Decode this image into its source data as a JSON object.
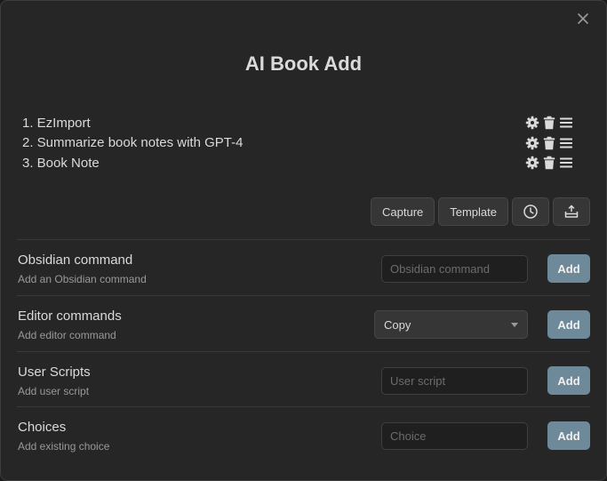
{
  "modal": {
    "title": "AI Book Add"
  },
  "steps": [
    {
      "label": "1. EzImport"
    },
    {
      "label": "2. Summarize book notes with GPT-4"
    },
    {
      "label": "3. Book Note"
    }
  ],
  "toolbar": {
    "capture_label": "Capture",
    "template_label": "Template",
    "icons": [
      "clock-icon",
      "tray-upload-icon"
    ]
  },
  "settings": {
    "obsidian": {
      "name": "Obsidian command",
      "desc": "Add an Obsidian command",
      "placeholder": "Obsidian command",
      "add_label": "Add"
    },
    "editor": {
      "name": "Editor commands",
      "desc": "Add editor command",
      "selected": "Copy",
      "add_label": "Add"
    },
    "scripts": {
      "name": "User Scripts",
      "desc": "Add user script",
      "placeholder": "User script",
      "add_label": "Add"
    },
    "choices": {
      "name": "Choices",
      "desc": "Add existing choice",
      "placeholder": "Choice",
      "add_label": "Add"
    }
  },
  "colors": {
    "background": "#262626",
    "accent": "#6e8a9a",
    "text": "#dadada",
    "muted": "#999999"
  }
}
